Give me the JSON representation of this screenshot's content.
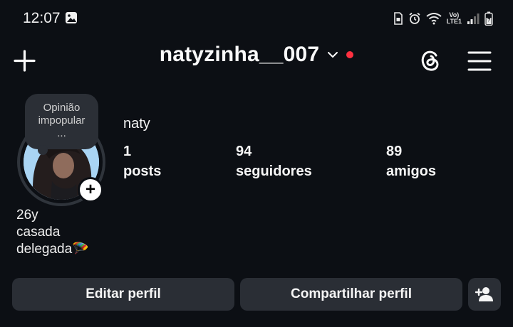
{
  "status_bar": {
    "time": "12:07",
    "icons": [
      "image-icon",
      "sim-icon",
      "alarm-icon",
      "wifi-icon",
      "volte-icon",
      "signal-icon",
      "battery-icon"
    ],
    "volte_line1": "Vo)",
    "volte_line2": "LTE1"
  },
  "header": {
    "username": "natyzinha__007",
    "notification_dot_color": "#ff3040",
    "icons": [
      "plus-icon",
      "chevron-down-icon",
      "threads-icon",
      "menu-icon"
    ]
  },
  "profile": {
    "note_line1": "Opinião",
    "note_line2": "impopular",
    "note_line3": "...",
    "display_name": "naty",
    "stats": [
      {
        "value": "1",
        "label": "posts"
      },
      {
        "value": "94",
        "label": "seguidores"
      },
      {
        "value": "89",
        "label": "amigos"
      }
    ],
    "bio": [
      "26y",
      "casada",
      "delegada🪂"
    ]
  },
  "actions": {
    "edit_label": "Editar perfil",
    "share_label": "Compartilhar perfil",
    "discover_icon": "add-person-icon"
  },
  "colors": {
    "background": "#0c0f14",
    "button_bg": "#2a2e35",
    "note_bg": "#2b2f36"
  }
}
